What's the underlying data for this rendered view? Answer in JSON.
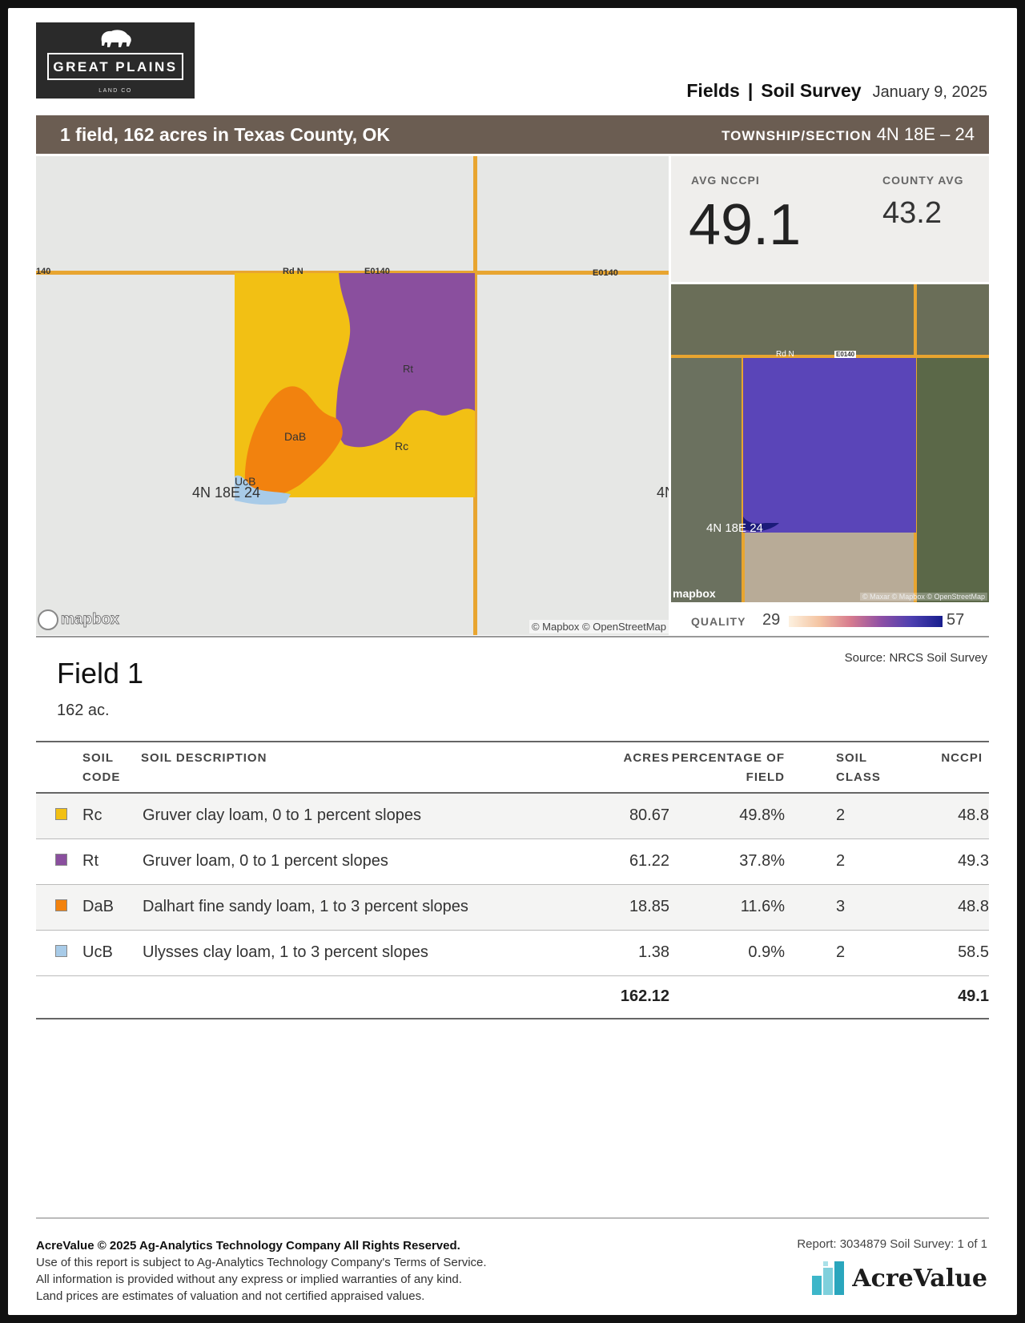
{
  "header": {
    "logo_brand": "GREAT PLAINS",
    "logo_sub": "LAND CO",
    "title_part1": "Fields",
    "title_sep": "|",
    "title_part2": "Soil Survey",
    "date": "January 9, 2025"
  },
  "band": {
    "summary": "1 field, 162 acres in Texas County, OK",
    "township_label": "TOWNSHIP/SECTION",
    "township_value": "4N 18E – 24"
  },
  "map_left": {
    "road_labels": [
      "140",
      "Rd N",
      "E0140",
      "E0140",
      "4N",
      "4N 18E 24"
    ],
    "soil_labels": [
      "Rt",
      "DaB",
      "Rc",
      "UcB"
    ],
    "attribution": "© Mapbox © OpenStreetMap",
    "mapbox": "mapbox"
  },
  "stats": {
    "avg_label": "AVG NCCPI",
    "avg_value": "49.1",
    "county_label": "COUNTY AVG",
    "county_value": "43.2"
  },
  "map_right": {
    "road_labels": [
      "Rd N",
      "E0140",
      "4N 18E 24"
    ],
    "mapbox": "mapbox",
    "attribution": "© Maxar © Mapbox © OpenStreetMap"
  },
  "quality": {
    "label": "QUALITY",
    "min": "29",
    "max": "57",
    "gradient_colors": [
      "#fdf1e0",
      "#f4c4a2",
      "#d77b8e",
      "#8e4fa5",
      "#4c3fb0",
      "#181e8e"
    ]
  },
  "source": "Source: NRCS Soil Survey",
  "field": {
    "title": "Field 1",
    "acres": "162 ac."
  },
  "table": {
    "headers": {
      "soil_code_1": "SOIL",
      "soil_code_2": "CODE",
      "description": "SOIL DESCRIPTION",
      "acres": "ACRES",
      "pct_1": "PERCENTAGE OF",
      "pct_2": "FIELD",
      "class_1": "SOIL",
      "class_2": "CLASS",
      "nccpi": "NCCPI"
    },
    "rows": [
      {
        "color": "#f2c014",
        "code": "Rc",
        "description": "Gruver clay loam, 0 to 1 percent slopes",
        "acres": "80.67",
        "pct": "49.8%",
        "class": "2",
        "nccpi": "48.8"
      },
      {
        "color": "#8a4f9e",
        "code": "Rt",
        "description": "Gruver loam, 0 to 1 percent slopes",
        "acres": "61.22",
        "pct": "37.8%",
        "class": "2",
        "nccpi": "49.3"
      },
      {
        "color": "#f2820e",
        "code": "DaB",
        "description": "Dalhart fine sandy loam, 1 to 3 percent slopes",
        "acres": "18.85",
        "pct": "11.6%",
        "class": "3",
        "nccpi": "48.8"
      },
      {
        "color": "#a8cbe8",
        "code": "UcB",
        "description": "Ulysses clay loam, 1 to 3 percent slopes",
        "acres": "1.38",
        "pct": "0.9%",
        "class": "2",
        "nccpi": "58.5"
      }
    ],
    "total_acres": "162.12",
    "total_nccpi": "49.1"
  },
  "footer": {
    "line1": "AcreValue © 2025 Ag-Analytics Technology Company All Rights Reserved.",
    "line2": "Use of this report is subject to Ag-Analytics Technology Company's Terms of Service.",
    "line3": "All information is provided without any express or implied warranties of any kind.",
    "line4": "Land prices are estimates of valuation and not certified appraised values.",
    "report": "Report: 3034879 Soil Survey: 1 of 1",
    "brand": "AcreValue"
  }
}
